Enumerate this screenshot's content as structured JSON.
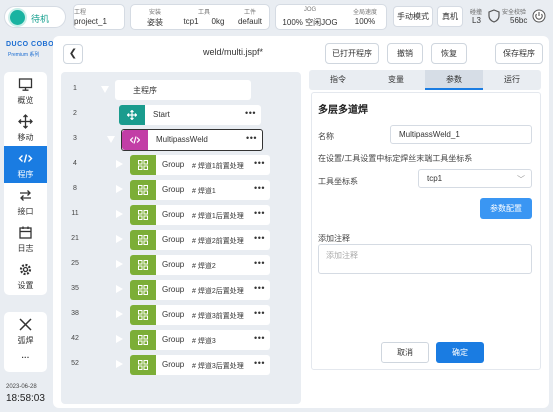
{
  "topbar": {
    "status": "待机",
    "project": {
      "k": "工程",
      "v": "project_1"
    },
    "install": {
      "k": "安装",
      "v": "姿装"
    },
    "tool": {
      "k": "工具",
      "v": "tcp1"
    },
    "payload": {
      "v": "0kg"
    },
    "workpiece": {
      "k": "工件",
      "v": "default"
    },
    "jog": {
      "k": "JOG",
      "v": "100%  空闲JOG"
    },
    "speed": {
      "k": "全局速度",
      "v": "100%"
    },
    "mode_button": "手动模式",
    "real_button": "真机",
    "collision": {
      "k": "碰撞",
      "v": "L3"
    },
    "safety": {
      "k": "安全校验",
      "v": "56bc"
    }
  },
  "logo": {
    "name": "DUCO COBOT",
    "sub": "Premium 系列"
  },
  "sidebar": {
    "items": [
      {
        "label": "概览",
        "icon": "monitor-icon"
      },
      {
        "label": "移动",
        "icon": "move-icon"
      },
      {
        "label": "程序",
        "icon": "code-icon"
      },
      {
        "label": "接口",
        "icon": "interface-icon"
      },
      {
        "label": "日志",
        "icon": "calendar-icon"
      },
      {
        "label": "设置",
        "icon": "gear-icon"
      }
    ],
    "tools": [
      {
        "label": "弧焊",
        "icon": "welding-icon"
      },
      {
        "label": "···"
      }
    ]
  },
  "datetime": {
    "date": "2023-06-28",
    "time": "18:58:03"
  },
  "header": {
    "file_title": "weld/multi.jspf*",
    "open_program": "已打开程序",
    "undo": "撤销",
    "redo": "恢复",
    "save_program": "保存程序"
  },
  "tree": {
    "root": {
      "line": "1",
      "label": "主程序"
    },
    "start": {
      "line": "2",
      "label": "Start"
    },
    "multipass": {
      "line": "3",
      "label": "MultipassWeld"
    },
    "groups": [
      {
        "line": "4",
        "name": "Group",
        "comment": "# 焊道1前置处理"
      },
      {
        "line": "8",
        "name": "Group",
        "comment": "# 焊道1"
      },
      {
        "line": "11",
        "name": "Group",
        "comment": "# 焊道1后置处理"
      },
      {
        "line": "21",
        "name": "Group",
        "comment": "# 焊道2前置处理"
      },
      {
        "line": "25",
        "name": "Group",
        "comment": "# 焊道2"
      },
      {
        "line": "35",
        "name": "Group",
        "comment": "# 焊道2后置处理"
      },
      {
        "line": "38",
        "name": "Group",
        "comment": "# 焊道3前置处理"
      },
      {
        "line": "42",
        "name": "Group",
        "comment": "# 焊道3"
      },
      {
        "line": "52",
        "name": "Group",
        "comment": "# 焊道3后置处理"
      }
    ]
  },
  "tabs": [
    "指令",
    "变量",
    "参数",
    "运行"
  ],
  "active_tab": "参数",
  "panel": {
    "title": "多层多道焊",
    "name_label": "名称",
    "name_value": "MultipassWeld_1",
    "hint": "在设置/工具设置中标定焊丝末端工具坐标系",
    "tool_label": "工具坐标系",
    "tool_value": "tcp1",
    "param_button": "参数配置",
    "comment_label": "添加注释",
    "comment_placeholder": "添加注释"
  },
  "footer": {
    "cancel": "取消",
    "ok": "确定"
  },
  "colors": {
    "accent": "#1a7ce2",
    "group": "#7cae37",
    "start": "#1a9c8e",
    "multipass": "#c23ea6",
    "status": "#19b3a1"
  }
}
